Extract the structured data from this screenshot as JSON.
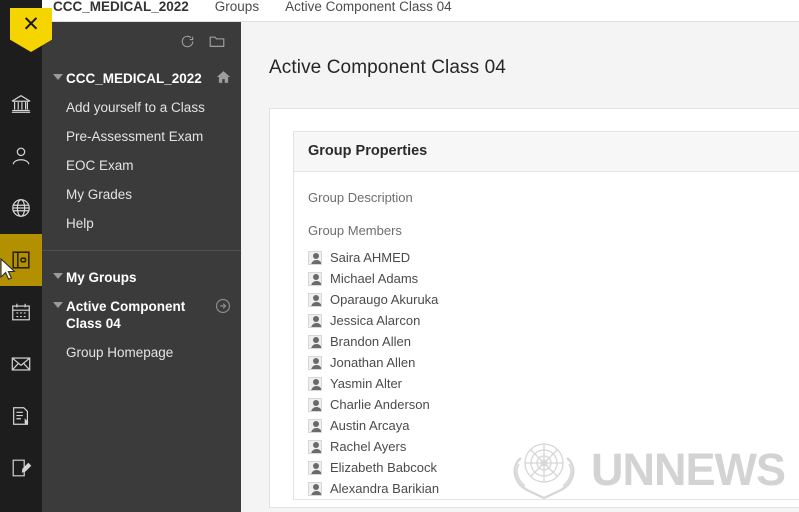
{
  "breadcrumb": {
    "items": [
      {
        "label": "CCC_MEDICAL_2022",
        "bold": true
      },
      {
        "label": "Groups",
        "bold": false
      },
      {
        "label": "Active Component Class 04",
        "bold": false
      }
    ]
  },
  "close_tag": {
    "glyph": "✕",
    "name": "close-panel-button",
    "color": "#f5d400"
  },
  "icon_rail": {
    "items": [
      {
        "name": "institution-icon",
        "label": "Institution"
      },
      {
        "name": "profile-icon",
        "label": "Profile"
      },
      {
        "name": "globe-icon",
        "label": "Community"
      },
      {
        "name": "courses-icon",
        "label": "Courses",
        "active": true
      },
      {
        "name": "calendar-icon",
        "label": "Calendar"
      },
      {
        "name": "mail-icon",
        "label": "Messages"
      },
      {
        "name": "grades-icon",
        "label": "Grades"
      },
      {
        "name": "tools-icon",
        "label": "Tools"
      }
    ],
    "active_color": "#b39000"
  },
  "panel": {
    "tools": [
      {
        "name": "refresh-icon",
        "label": "Refresh"
      },
      {
        "name": "folder-icon",
        "label": "Course Content"
      }
    ],
    "course": {
      "title": "CCC_MEDICAL_2022",
      "home_icon": "home-icon",
      "items": [
        {
          "label": "Add yourself to a Class"
        },
        {
          "label": "Pre-Assessment Exam"
        },
        {
          "label": "EOC Exam"
        },
        {
          "label": "My Grades"
        },
        {
          "label": "Help"
        }
      ]
    },
    "groups": {
      "title": "My Groups",
      "group_title": "Active Component Class 04",
      "group_arrow_icon": "arrow-right-circle-icon",
      "items": [
        {
          "label": "Group Homepage"
        }
      ]
    }
  },
  "main": {
    "title": "Active Component Class 04",
    "properties": {
      "header": "Group Properties",
      "description_label": "Group Description",
      "members_label": "Group Members",
      "members": [
        "Saira AHMED",
        "Michael Adams",
        "Oparaugo Akuruka",
        "Jessica Alarcon",
        "Brandon Allen",
        "Jonathan Allen",
        "Yasmin Alter",
        "Charlie Anderson",
        "Austin Arcaya",
        "Rachel Ayers",
        "Elizabeth Babcock",
        "Alexandra Barikian"
      ]
    }
  },
  "watermark": {
    "text": "UNNEWS",
    "emblem": "un-laurel-emblem",
    "color": "#d3d3d3"
  },
  "cursor": {
    "name": "mouse-pointer"
  }
}
